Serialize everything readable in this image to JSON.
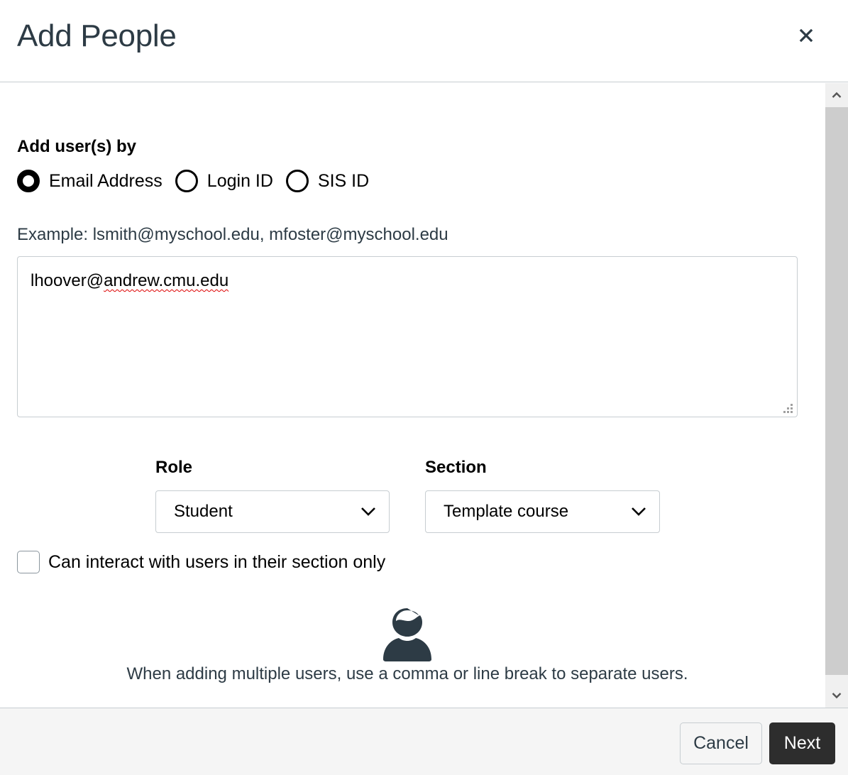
{
  "header": {
    "title": "Add People",
    "close_icon": "close-icon"
  },
  "form": {
    "add_by_label": "Add user(s) by",
    "add_by_options": [
      {
        "label": "Email Address",
        "checked": true
      },
      {
        "label": "Login ID",
        "checked": false
      },
      {
        "label": "SIS ID",
        "checked": false
      }
    ],
    "example_text": "Example: lsmith@myschool.edu, mfoster@myschool.edu",
    "users_input": {
      "value_prefix": "lhoover@",
      "value_misspelled": "andrew.cmu.edu"
    },
    "role": {
      "label": "Role",
      "selected": "Student"
    },
    "section": {
      "label": "Section",
      "selected": "Template course"
    },
    "limit_checkbox": {
      "label": "Can interact with users in their section only",
      "checked": false
    },
    "hint_icon": "user-icon",
    "hint_text": "When adding multiple users, use a comma or line break to separate users."
  },
  "footer": {
    "cancel_label": "Cancel",
    "next_label": "Next"
  },
  "colors": {
    "text_primary": "#2d3b45",
    "primary_button": "#2d2d2d",
    "footer_bg": "#f5f5f5",
    "border": "#c7cdd1"
  }
}
